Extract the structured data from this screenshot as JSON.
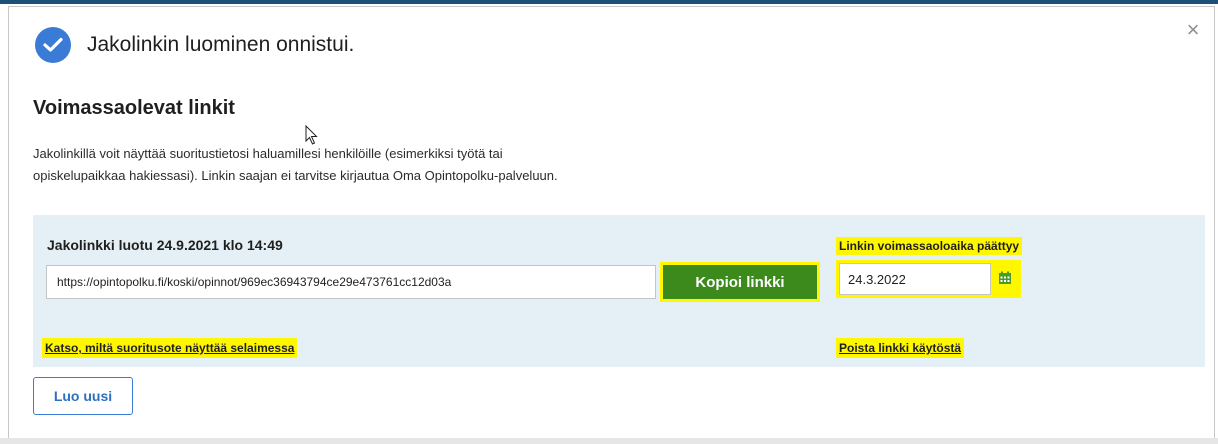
{
  "dialog": {
    "close_symbol": "×",
    "success_icon": "check-circle-icon",
    "success_title": "Jakolinkin luominen onnistui.",
    "section_title": "Voimassaolevat linkit",
    "description": "Jakolinkillä voit näyttää suoritustietosi haluamillesi henkilöille (esimerkiksi työtä tai opiskelupaikkaa hakiessasi). Linkin saajan ei tarvitse kirjautua Oma Opintopolku-palveluun."
  },
  "share_link": {
    "created_text": "Jakolinkki luotu 24.9.2021 klo 14:49",
    "url": "https://opintopolku.fi/koski/opinnot/969ec36943794ce29e473761cc12d03a",
    "copy_label": "Kopioi linkki",
    "expiry_label": "Linkin voimassaoloaika päättyy",
    "expiry_date": "24.3.2022",
    "calendar_icon": "calendar-icon",
    "preview_link": "Katso, miltä suoritusote näyttää selaimessa",
    "disable_link": "Poista linkki käytöstä"
  },
  "actions": {
    "new_label": "Luo uusi"
  },
  "colors": {
    "accent_blue": "#3a7bd5",
    "copy_green": "#3d8a1c",
    "highlight_yellow": "#fff700",
    "panel_bg": "#e4f0f5"
  }
}
